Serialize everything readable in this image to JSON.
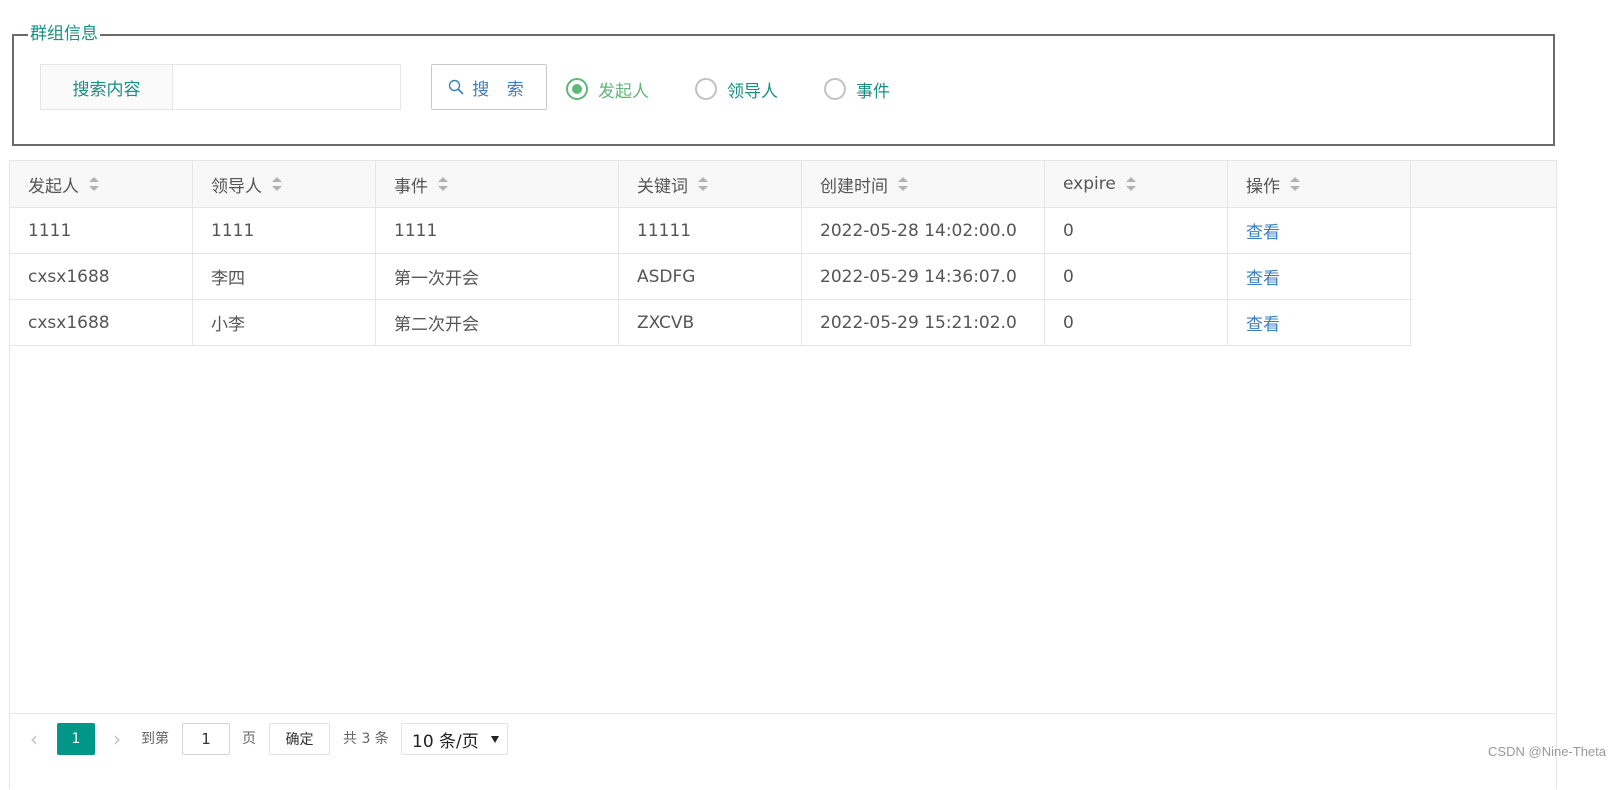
{
  "group": {
    "legend": "群组信息",
    "search_label": "搜索内容",
    "search_value": "",
    "search_button": "搜 索",
    "radios": [
      {
        "label": "发起人",
        "checked": true
      },
      {
        "label": "领导人",
        "checked": false
      },
      {
        "label": "事件",
        "checked": false
      }
    ]
  },
  "table": {
    "columns": [
      "发起人",
      "领导人",
      "事件",
      "关键词",
      "创建时间",
      "expire",
      "操作"
    ],
    "rows": [
      [
        "1111",
        "1111",
        "1111",
        "11111",
        "2022-05-28 14:02:00.0",
        "0",
        "查看"
      ],
      [
        "cxsx1688",
        "李四",
        "第一次开会",
        "ASDFG",
        "2022-05-29 14:36:07.0",
        "0",
        "查看"
      ],
      [
        "cxsx1688",
        "小李",
        "第二次开会",
        "ZXCVB",
        "2022-05-29 15:21:02.0",
        "0",
        "查看"
      ]
    ]
  },
  "pager": {
    "prev": "‹",
    "next": "›",
    "current_page": "1",
    "goto_label": "到第",
    "goto_value": "1",
    "page_unit": "页",
    "confirm": "确定",
    "total": "共 3 条",
    "page_size": "10 条/页"
  },
  "watermark": "CSDN @Nine-Theta",
  "colors": {
    "accent_teal": "#009688",
    "radio_green": "#5fb878",
    "link_blue": "#3c7fc1"
  }
}
